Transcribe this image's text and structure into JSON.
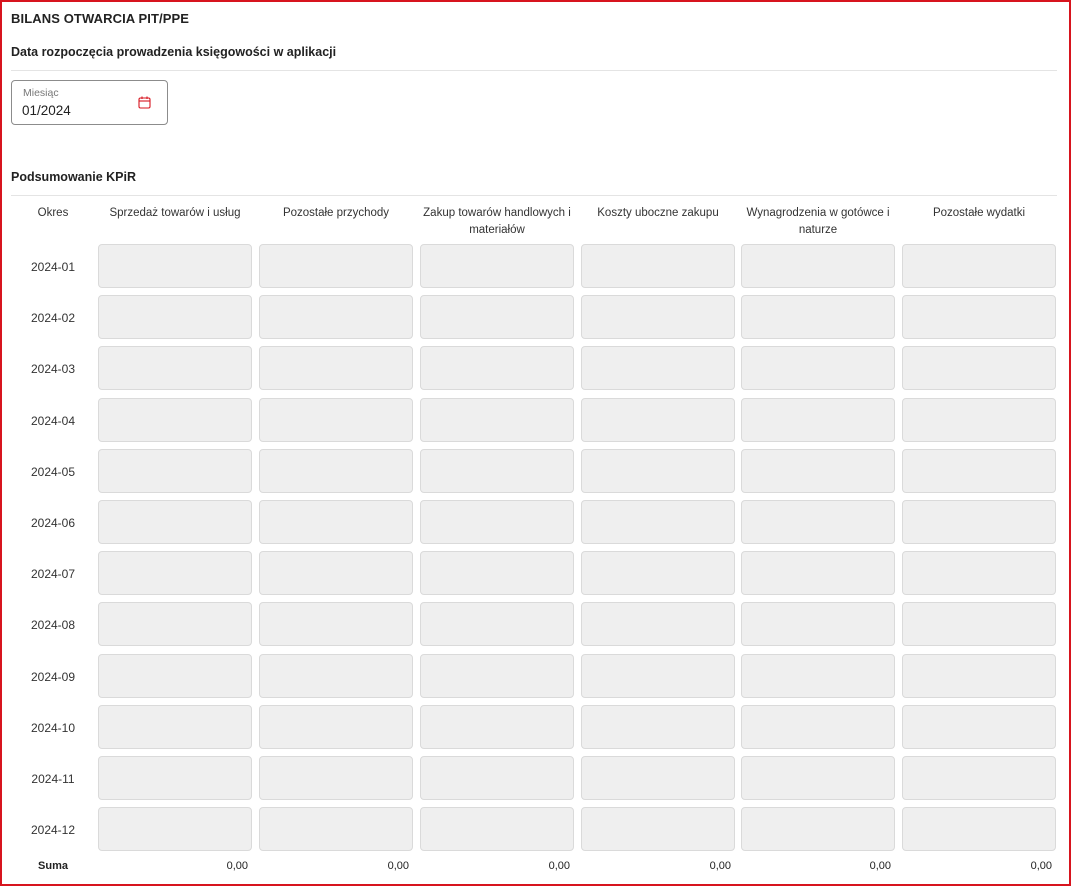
{
  "header": {
    "title": "BILANS OTWARCIA PIT/PPE",
    "subtitle": "Data rozpoczęcia prowadzenia księgowości w aplikacji"
  },
  "date_field": {
    "label": "Miesiąc",
    "value": "01/2024",
    "icon": "calendar-icon",
    "icon_color": "#d7141e"
  },
  "summary": {
    "title": "Podsumowanie KPiR",
    "period_header": "Okres",
    "columns": [
      "Sprzedaż towarów i usług",
      "Pozostałe przychody",
      "Zakup towarów handlowych i materiałów",
      "Koszty uboczne zakupu",
      "Wynagrodzenia w gotówce i naturze",
      "Pozostałe wydatki"
    ],
    "periods": [
      "2024-01",
      "2024-02",
      "2024-03",
      "2024-04",
      "2024-05",
      "2024-06",
      "2024-07",
      "2024-08",
      "2024-09",
      "2024-10",
      "2024-11",
      "2024-12"
    ],
    "sum_label": "Suma",
    "sums": [
      "0,00",
      "0,00",
      "0,00",
      "0,00",
      "0,00",
      "0,00"
    ]
  },
  "colors": {
    "frame_border": "#d7141e",
    "cell_bg": "#efefef"
  }
}
